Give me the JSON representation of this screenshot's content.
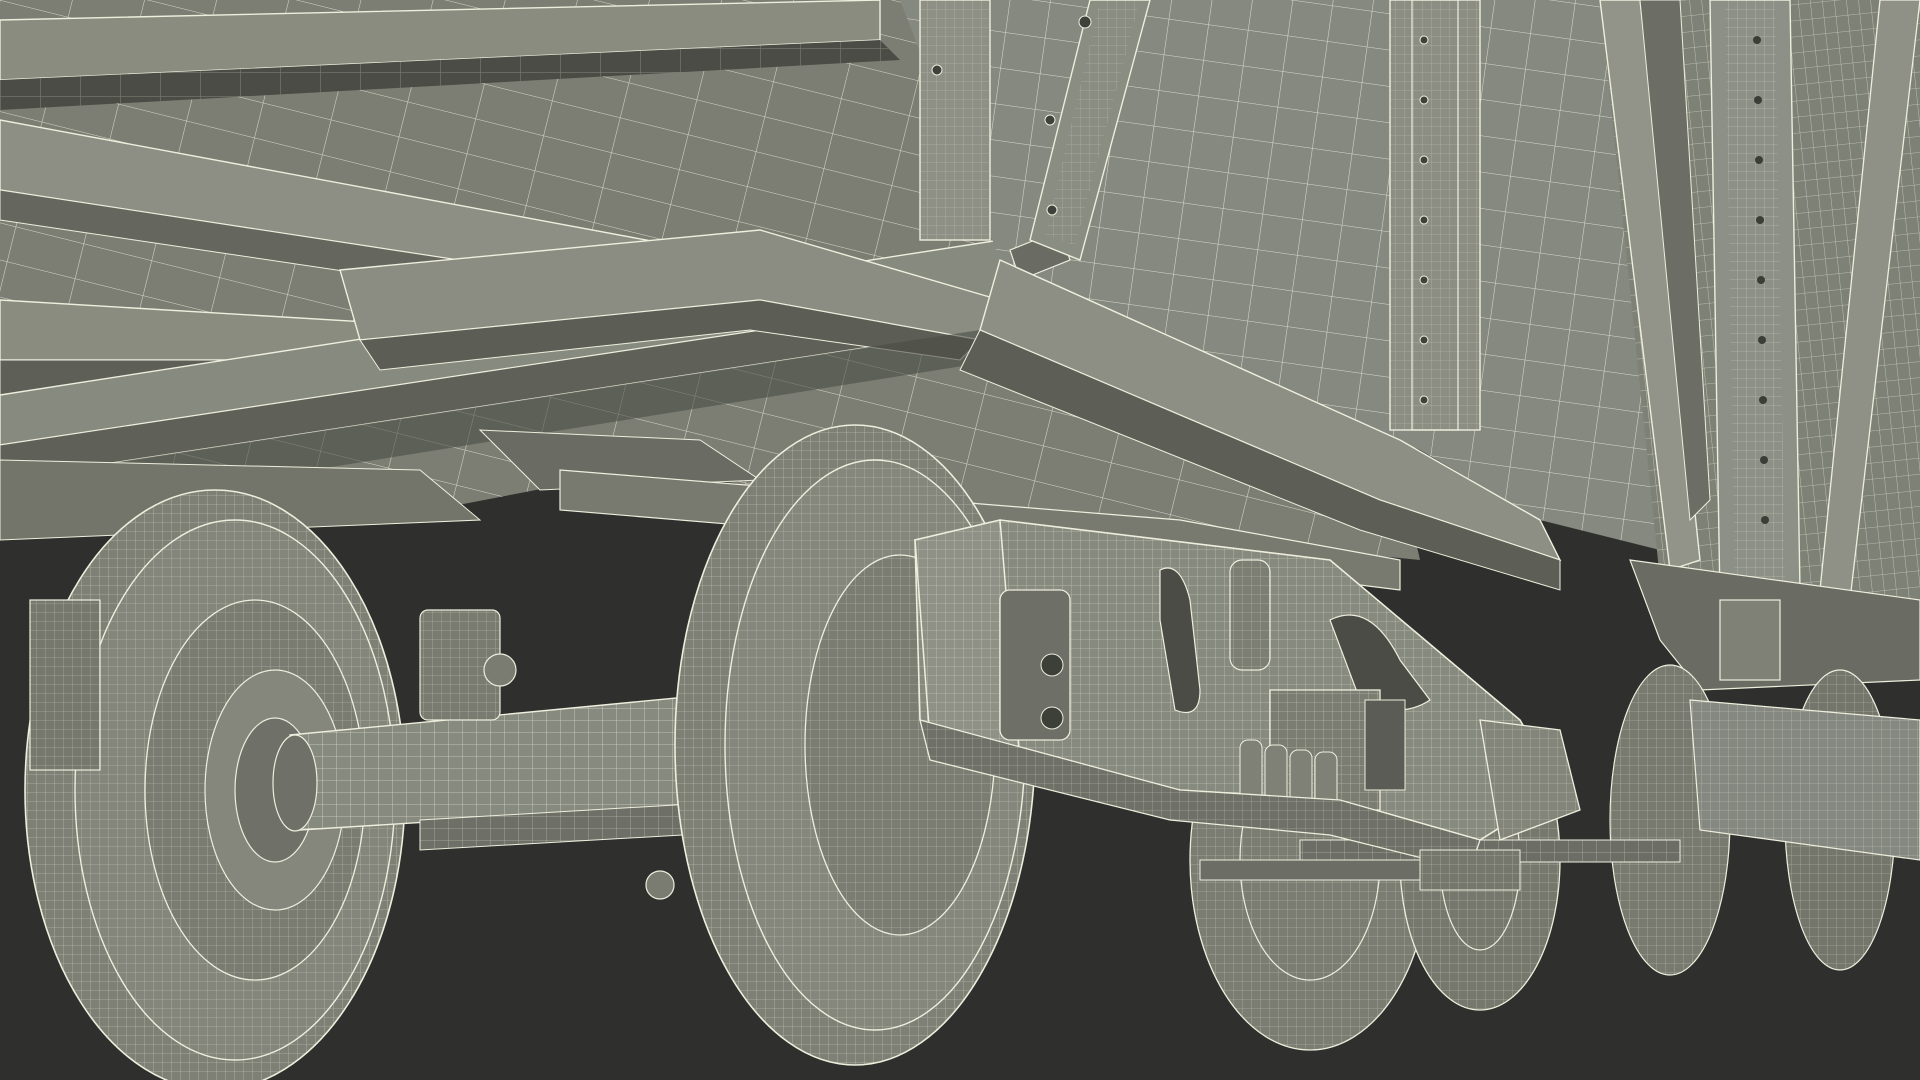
{
  "scene": {
    "subject": "freight-wagon-undercarriage-wireframe",
    "colors": {
      "background": "#2f302e",
      "surface": "#7f8176",
      "surface_light": "#8d8f84",
      "surface_dark": "#6c6e64",
      "shadow": "#4a4c45",
      "wire": "#eeeedd"
    }
  }
}
